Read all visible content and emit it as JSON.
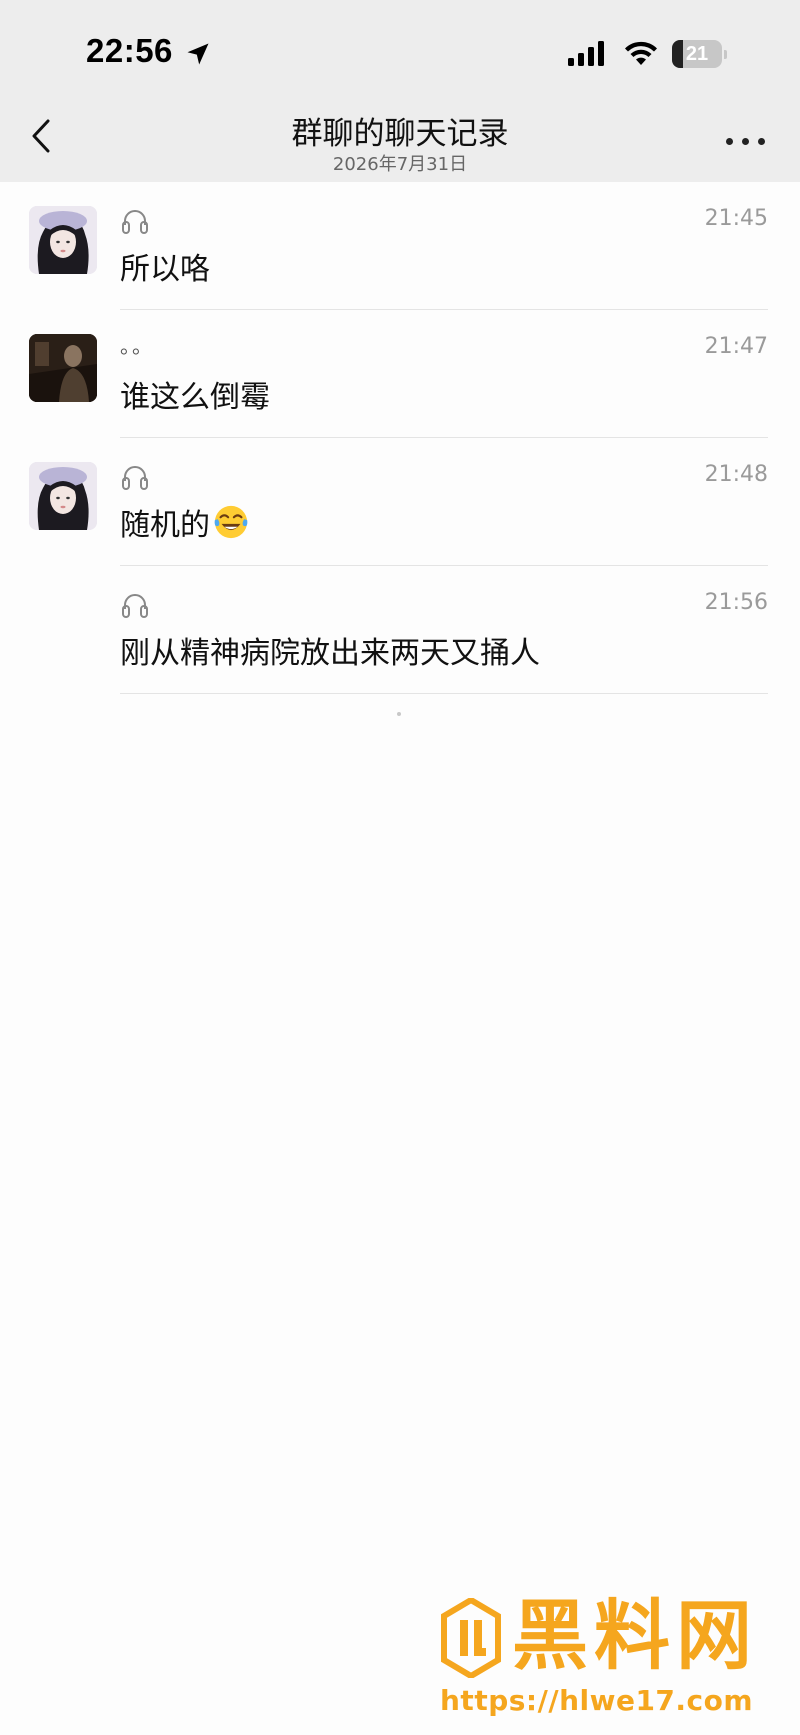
{
  "status_bar": {
    "time": "22:56",
    "battery_label": "21",
    "battery_level": 0.21,
    "icons": [
      "location-arrow-icon",
      "cellular-signal-icon",
      "wifi-icon",
      "battery-icon"
    ]
  },
  "nav": {
    "title": "群聊的聊天记录",
    "subtitle": "2026年7月31日",
    "back_icon": "chevron-left-icon",
    "more_icon": "ellipsis-icon"
  },
  "messages": [
    {
      "avatar": "girl",
      "sender_icon": "headphones-icon",
      "time": "21:45",
      "text": "所以咯"
    },
    {
      "avatar": "dark-photo",
      "sender_name": "。。",
      "time": "21:47",
      "text": "谁这么倒霉"
    },
    {
      "avatar": "girl",
      "sender_icon": "headphones-icon",
      "time": "21:48",
      "text": "随机的",
      "emoji": "tears-of-joy-emoji"
    },
    {
      "avatar": "none",
      "sender_icon": "headphones-icon",
      "time": "21:56",
      "text": "刚从精神病院放出来两天又捅人"
    }
  ],
  "watermark": {
    "brand": "黑料网",
    "url": "https://hlwe17.com",
    "color": "#f5a61e"
  }
}
